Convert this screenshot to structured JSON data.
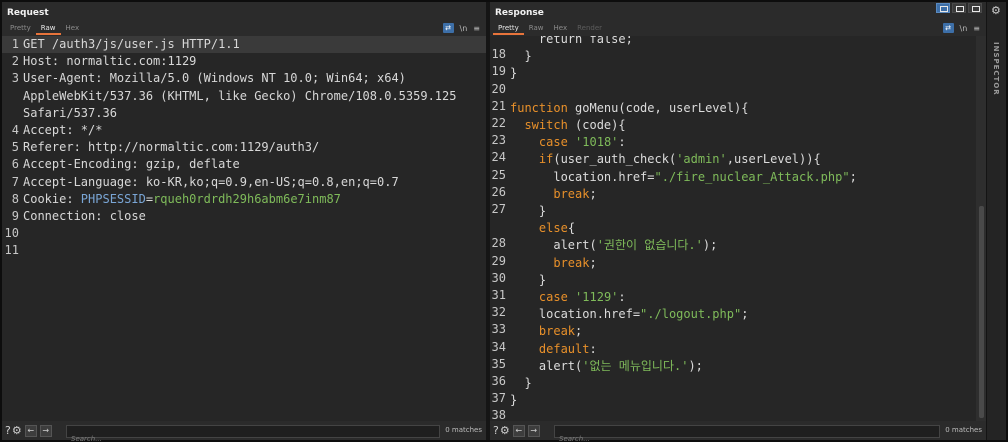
{
  "request": {
    "title": "Request",
    "tabs": [
      "Pretty",
      "Raw",
      "Hex"
    ],
    "active_tab": "Raw",
    "tools": {
      "wrap": "⇄",
      "newline": "\\n",
      "menu": "≡"
    },
    "lines": [
      {
        "num": "1",
        "text": "GET /auth3/js/user.js HTTP/1.1"
      },
      {
        "num": "2",
        "text": "Host: normaltic.com:1129"
      },
      {
        "num": "3",
        "text": "User-Agent: Mozilla/5.0 (Windows NT 10.0; Win64; x64)"
      },
      {
        "num": "",
        "text": "AppleWebKit/537.36 (KHTML, like Gecko) Chrome/108.0.5359.125"
      },
      {
        "num": "",
        "text": "Safari/537.36"
      },
      {
        "num": "4",
        "text": "Accept: */*"
      },
      {
        "num": "5",
        "text": "Referer: http://normaltic.com:1129/auth3/"
      },
      {
        "num": "6",
        "text": "Accept-Encoding: gzip, deflate"
      },
      {
        "num": "7",
        "text": "Accept-Language: ko-KR,ko;q=0.9,en-US;q=0.8,en;q=0.7"
      },
      {
        "num": "8",
        "text": "Cookie: ",
        "cookie_key": "PHPSESSID",
        "cookie_eq": "=",
        "cookie_val": "rqueh0rdrdh29h6abm6e7inm87"
      },
      {
        "num": "9",
        "text": "Connection: close"
      },
      {
        "num": "10",
        "text": ""
      },
      {
        "num": "11",
        "text": ""
      }
    ],
    "search": {
      "placeholder": "Search...",
      "matches": "0 matches"
    }
  },
  "response": {
    "title": "Response",
    "tabs": [
      "Pretty",
      "Raw",
      "Hex",
      "Render"
    ],
    "active_tab": "Pretty",
    "tools": {
      "wrap": "⇄",
      "newline": "\\n",
      "menu": "≡"
    },
    "lines": [
      {
        "num": "",
        "parts": [
          [
            "    ",
            "p"
          ],
          [
            "return false;",
            "p"
          ]
        ]
      },
      {
        "num": "18",
        "parts": [
          [
            "  }",
            "p"
          ]
        ]
      },
      {
        "num": "19",
        "parts": [
          [
            "}",
            "p"
          ]
        ]
      },
      {
        "num": "20",
        "parts": []
      },
      {
        "num": "21",
        "parts": [
          [
            "function",
            "k"
          ],
          [
            " goMenu(code, userLevel){",
            "p"
          ]
        ]
      },
      {
        "num": "22",
        "parts": [
          [
            "  ",
            "p"
          ],
          [
            "switch",
            "k"
          ],
          [
            " (code){",
            "p"
          ]
        ]
      },
      {
        "num": "23",
        "parts": [
          [
            "    ",
            "p"
          ],
          [
            "case",
            "k"
          ],
          [
            " ",
            "p"
          ],
          [
            "'1018'",
            "s"
          ],
          [
            ":",
            "p"
          ]
        ]
      },
      {
        "num": "24",
        "parts": [
          [
            "    ",
            "p"
          ],
          [
            "if",
            "k"
          ],
          [
            "(user_auth_check(",
            "p"
          ],
          [
            "'admin'",
            "s"
          ],
          [
            ",userLevel)){",
            "p"
          ]
        ]
      },
      {
        "num": "25",
        "parts": [
          [
            "      location.href=",
            "p"
          ],
          [
            "\"./fire_nuclear_Attack.php\"",
            "s"
          ],
          [
            ";",
            "p"
          ]
        ]
      },
      {
        "num": "26",
        "parts": [
          [
            "      ",
            "p"
          ],
          [
            "break",
            "k"
          ],
          [
            ";",
            "p"
          ]
        ]
      },
      {
        "num": "27",
        "parts": [
          [
            "    }",
            "p"
          ]
        ]
      },
      {
        "num": "",
        "parts": [
          [
            "    ",
            "p"
          ],
          [
            "else",
            "k"
          ],
          [
            "{",
            "p"
          ]
        ]
      },
      {
        "num": "28",
        "parts": [
          [
            "      alert(",
            "p"
          ],
          [
            "'권한이 없습니다.'",
            "s"
          ],
          [
            ");",
            "p"
          ]
        ]
      },
      {
        "num": "29",
        "parts": [
          [
            "      ",
            "p"
          ],
          [
            "break",
            "k"
          ],
          [
            ";",
            "p"
          ]
        ]
      },
      {
        "num": "30",
        "parts": [
          [
            "    }",
            "p"
          ]
        ]
      },
      {
        "num": "31",
        "parts": [
          [
            "    ",
            "p"
          ],
          [
            "case",
            "k"
          ],
          [
            " ",
            "p"
          ],
          [
            "'1129'",
            "s"
          ],
          [
            ":",
            "p"
          ]
        ]
      },
      {
        "num": "32",
        "parts": [
          [
            "    location.href=",
            "p"
          ],
          [
            "\"./logout.php\"",
            "s"
          ],
          [
            ";",
            "p"
          ]
        ]
      },
      {
        "num": "33",
        "parts": [
          [
            "    ",
            "p"
          ],
          [
            "break",
            "k"
          ],
          [
            ";",
            "p"
          ]
        ]
      },
      {
        "num": "34",
        "parts": [
          [
            "    ",
            "p"
          ],
          [
            "default",
            "k"
          ],
          [
            ":",
            "p"
          ]
        ]
      },
      {
        "num": "35",
        "parts": [
          [
            "    alert(",
            "p"
          ],
          [
            "'없는 메뉴입니다.'",
            "s"
          ],
          [
            ");",
            "p"
          ]
        ]
      },
      {
        "num": "36",
        "parts": [
          [
            "  }",
            "p"
          ]
        ]
      },
      {
        "num": "37",
        "parts": [
          [
            "}",
            "p"
          ]
        ]
      },
      {
        "num": "38",
        "parts": []
      }
    ],
    "search": {
      "placeholder": "Search...",
      "matches": "0 matches"
    }
  },
  "inspector": {
    "label": "INSPECTOR"
  },
  "colors": {
    "keyword": "#e8902a",
    "string": "#7fbb5a",
    "accent": "#3d6fa8",
    "tab_underline": "#e8743b"
  }
}
